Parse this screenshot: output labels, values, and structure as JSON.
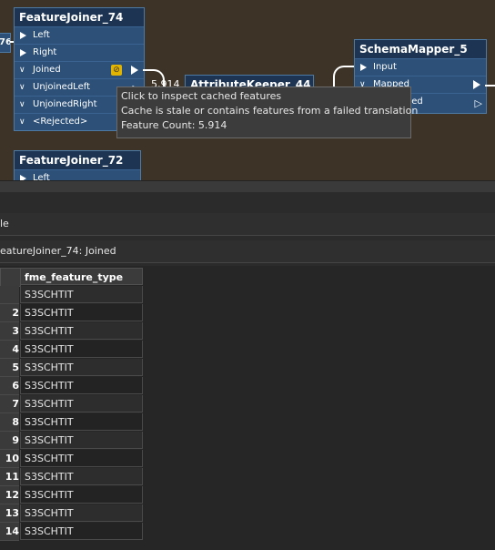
{
  "canvas": {
    "left_stub_label": "76",
    "nodes": {
      "feature_joiner_74": {
        "title": "FeatureJoiner_74",
        "ports": [
          "Left",
          "Right",
          "Joined",
          "UnjoinedLeft",
          "UnjoinedRight",
          "<Rejected>"
        ]
      },
      "attribute_keeper_44": {
        "title": "AttributeKeeper_44"
      },
      "schema_mapper_5": {
        "title": "SchemaMapper_5",
        "ports": [
          "Input",
          "Mapped",
          "Unmapped"
        ]
      },
      "feature_joiner_72": {
        "title": "FeatureJoiner_72",
        "ports": [
          "Left"
        ]
      }
    },
    "connection_count_label": "5,914",
    "tooltip": {
      "line1": "Click to inspect cached features",
      "line2": "Cache is stale or contains features from a failed translation",
      "line3": "Feature Count: 5.914"
    }
  },
  "inspector": {
    "table_label": "le",
    "source_label": "eatureJoiner_74: Joined",
    "column_header": "fme_feature_type",
    "rows": [
      {
        "num": "",
        "value": "S3SCHTIT"
      },
      {
        "num": "2",
        "value": "S3SCHTIT"
      },
      {
        "num": "3",
        "value": "S3SCHTIT"
      },
      {
        "num": "4",
        "value": "S3SCHTIT"
      },
      {
        "num": "5",
        "value": "S3SCHTIT"
      },
      {
        "num": "6",
        "value": "S3SCHTIT"
      },
      {
        "num": "7",
        "value": "S3SCHTIT"
      },
      {
        "num": "8",
        "value": "S3SCHTIT"
      },
      {
        "num": "9",
        "value": "S3SCHTIT"
      },
      {
        "num": "10",
        "value": "S3SCHTIT"
      },
      {
        "num": "11",
        "value": "S3SCHTIT"
      },
      {
        "num": "12",
        "value": "S3SCHTIT"
      },
      {
        "num": "13",
        "value": "S3SCHTIT"
      },
      {
        "num": "14",
        "value": "S3SCHTIT"
      }
    ]
  }
}
